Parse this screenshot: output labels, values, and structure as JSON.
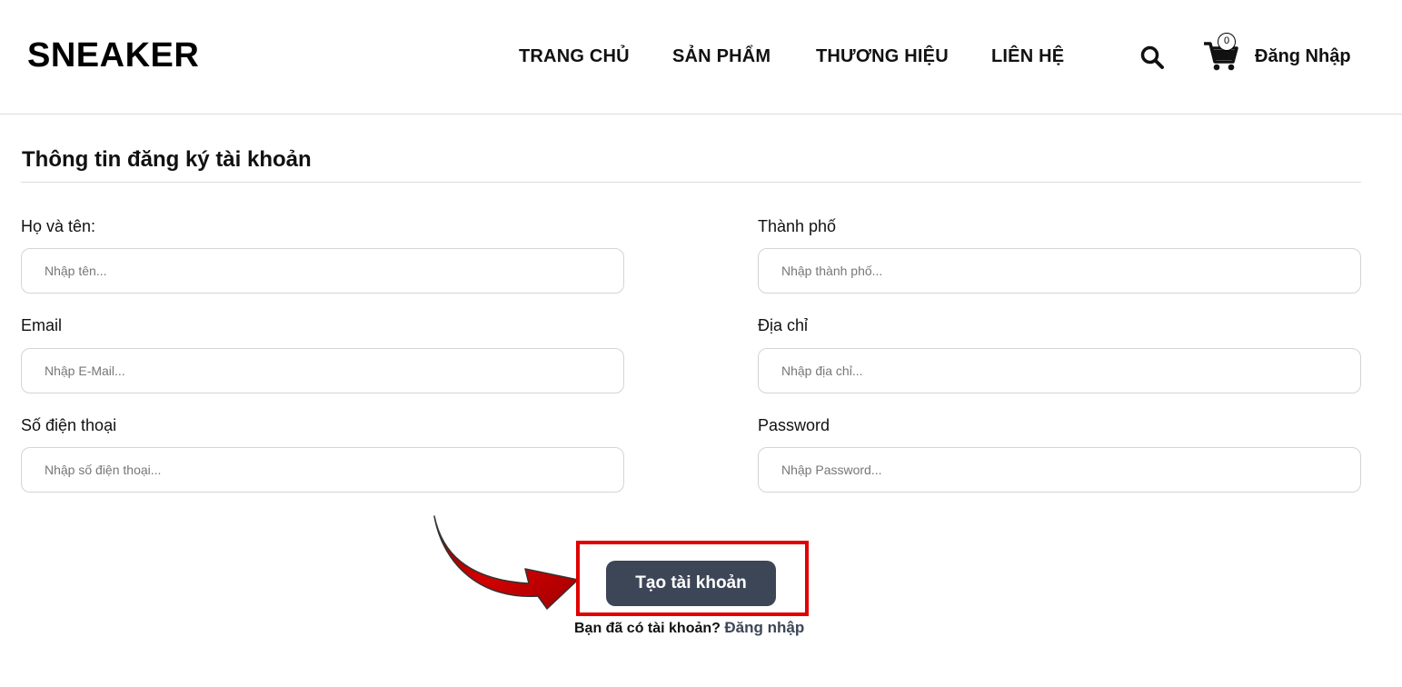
{
  "header": {
    "logo": "SNEAKER",
    "nav": [
      {
        "label": "TRANG CHỦ"
      },
      {
        "label": "SẢN PHẨM"
      },
      {
        "label": "THƯƠNG HIỆU"
      },
      {
        "label": "LIÊN HỆ"
      }
    ],
    "search_icon": "search-icon",
    "cart_icon": "cart-icon",
    "cart_count": "0",
    "login_label": "Đăng Nhập"
  },
  "form": {
    "title": "Thông tin đăng ký tài khoản",
    "fields": {
      "fullname": {
        "label": "Họ và tên:",
        "placeholder": "Nhập tên...",
        "value": ""
      },
      "email": {
        "label": "Email",
        "placeholder": "Nhập E-Mail...",
        "value": ""
      },
      "phone": {
        "label": "Số điện thoại",
        "placeholder": "Nhập số điện thoại...",
        "value": ""
      },
      "city": {
        "label": "Thành phố",
        "placeholder": "Nhập thành phố...",
        "value": ""
      },
      "address": {
        "label": "Địa chỉ",
        "placeholder": "Nhập địa chỉ...",
        "value": ""
      },
      "password": {
        "label": "Password",
        "placeholder": "Nhập Password...",
        "value": ""
      }
    },
    "submit_label": "Tạo tài khoản",
    "have_account_text": "Bạn đã có tài khoản?",
    "login_link": "Đăng nhập"
  },
  "colors": {
    "button_bg": "#3d4657",
    "highlight_border": "#e00000",
    "arrow_fill": "#c00000"
  }
}
